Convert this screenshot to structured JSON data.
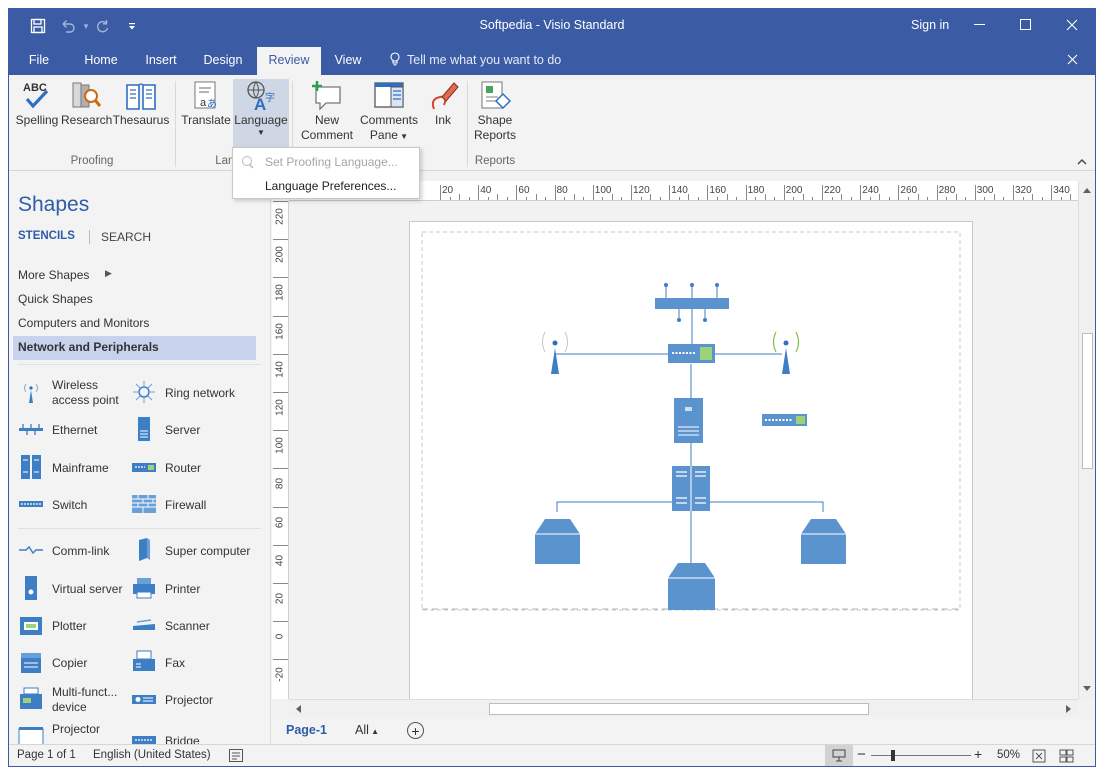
{
  "window": {
    "title": "Softpedia - Visio Standard",
    "sign_in": "Sign in",
    "tell_me": "Tell me what you want to do"
  },
  "tabs": [
    {
      "label": "File"
    },
    {
      "label": "Home"
    },
    {
      "label": "Insert"
    },
    {
      "label": "Design"
    },
    {
      "label": "Review",
      "active": true
    },
    {
      "label": "View"
    }
  ],
  "ribbon": {
    "proofing": {
      "group": "Proofing",
      "spelling": "Spelling",
      "research": "Research",
      "thesaurus": "Thesaurus"
    },
    "language": {
      "group": "Lang",
      "translate": "Translate",
      "language": "Language"
    },
    "comments": {
      "new_comment_1": "New",
      "new_comment_2": "Comment",
      "comments_pane_1": "Comments",
      "comments_pane_2": "Pane"
    },
    "ink": "Ink",
    "reports": {
      "group": "Reports",
      "shape_reports_1": "Shape",
      "shape_reports_2": "Reports"
    }
  },
  "language_menu": {
    "items": [
      {
        "label": "Set Proofing Language...",
        "enabled": false
      },
      {
        "label": "Language Preferences...",
        "enabled": true
      }
    ]
  },
  "shapes_pane": {
    "title": "Shapes",
    "tab_stencils": "STENCILS",
    "tab_search": "SEARCH",
    "stencils": [
      {
        "label": "More Shapes"
      },
      {
        "label": "Quick Shapes"
      },
      {
        "label": "Computers and Monitors"
      },
      {
        "label": "Network and Peripherals",
        "selected": true
      }
    ],
    "shapes": [
      {
        "label": "Wireless access point",
        "icon": "wireless-access-point-icon"
      },
      {
        "label": "Ring network",
        "icon": "ring-network-icon"
      },
      {
        "label": "Ethernet",
        "icon": "ethernet-icon"
      },
      {
        "label": "Server",
        "icon": "server-icon"
      },
      {
        "label": "Mainframe",
        "icon": "mainframe-icon"
      },
      {
        "label": "Router",
        "icon": "router-icon"
      },
      {
        "label": "Switch",
        "icon": "switch-icon"
      },
      {
        "label": "Firewall",
        "icon": "firewall-icon"
      },
      {
        "label": "Comm-link",
        "icon": "comm-link-icon"
      },
      {
        "label": "Super computer",
        "icon": "super-computer-icon"
      },
      {
        "label": "Virtual server",
        "icon": "virtual-server-icon"
      },
      {
        "label": "Printer",
        "icon": "printer-icon"
      },
      {
        "label": "Plotter",
        "icon": "plotter-icon"
      },
      {
        "label": "Scanner",
        "icon": "scanner-icon"
      },
      {
        "label": "Copier",
        "icon": "copier-icon"
      },
      {
        "label": "Fax",
        "icon": "fax-icon"
      },
      {
        "label": "Multi-funct... device",
        "icon": "multi-function-device-icon"
      },
      {
        "label": "Projector",
        "icon": "projector-icon"
      },
      {
        "label": "Projector",
        "icon": "projector-screen-icon"
      },
      {
        "label": "Bridge",
        "icon": "bridge-icon"
      }
    ]
  },
  "rulers": {
    "horizontal": [
      "20",
      "40",
      "60",
      "80",
      "100",
      "120",
      "140",
      "160",
      "180",
      "200",
      "220",
      "240",
      "260",
      "280",
      "300",
      "320",
      "340"
    ],
    "vertical": [
      "220",
      "200",
      "180",
      "160",
      "140",
      "120",
      "100",
      "80",
      "60",
      "40",
      "20",
      "0",
      "-20"
    ]
  },
  "page_tabs": {
    "current": "Page-1",
    "all": "All"
  },
  "status": {
    "page": "Page 1 of 1",
    "language": "English (United States)",
    "zoom": "50%"
  },
  "colors": {
    "brand": "#3b5ba5",
    "shape_fill": "#5b93cf",
    "selected_stencil": "#c7d2ec"
  }
}
